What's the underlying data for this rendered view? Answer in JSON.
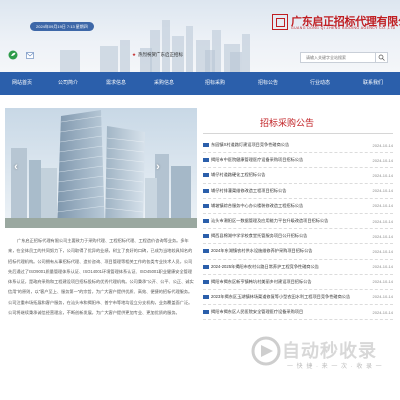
{
  "header": {
    "date_text": "2024年09月19日 7:13 星期四",
    "welcome_text": "热烈祝贺广东启正招标",
    "logo_title": "广东启正招标代理有限公司",
    "logo_subtitle": "GUANG DONG QI ZHENG BIDDING AGENCY CO.,LTD",
    "search_placeholder": "请输入关键字全站搜索"
  },
  "nav": {
    "items": [
      {
        "label": "网站首页"
      },
      {
        "label": "公司简介"
      },
      {
        "label": "需求信息"
      },
      {
        "label": "采购信息"
      },
      {
        "label": "招标采购"
      },
      {
        "label": "招标公告"
      },
      {
        "label": "行业动态"
      },
      {
        "label": "联系我们"
      }
    ]
  },
  "hero": {
    "prev_label": "‹",
    "next_label": "›"
  },
  "intro": {
    "text": "广东启正招标代理有限公司主要致力于采购代理、工程招标代理、工程造价咨询等业务。多年来，在全体员工的共同努力下，公司取得了优异的业绩，树立了良好的口碑，已成为当地较具知名的招标代理机构。公司拥有从事招标代理、造价咨询、项目管理等相关工作的各类专业技术人员，公司先后通过了ISO9001质量管理体系认证、ISO14001环境管理体系认证、ISO45001职业健康安全管理体系认证，是政府采购和工程建设项目招标投标的优秀代理机构。公司秉承“公开、公平、公正、诚实信用”的原则，以“客户至上、服务第一”的宗旨，为广大客户提供优质、高效、便捷的招标代理服务。公司注重市场拓展和客户服务，在汕头市和揭阳市、普宁市等地均设立分支机构，业务覆盖面广泛。公司将继续秉承诚信经营理念，不断创新发展，为广大客户提供更加专业、更加优质的服务。"
  },
  "announcements": {
    "title": "招标采购公告",
    "items": [
      {
        "title": "东园镇X村道路灯建设项目竞争性磋商公告",
        "date": "2024-10-14"
      },
      {
        "title": "揭阳市中医院健康管理医疗设备采购项目招标公告",
        "date": "2024-10-14"
      },
      {
        "title": "埔仔村道路硬化工程招标公告",
        "date": "2024-10-14"
      },
      {
        "title": "埔仔村排灌渠维修改造工程项目招标公告",
        "date": "2024-10-14"
      },
      {
        "title": "埔坡镇综合服务中心办公楼装修改造工程招标公告",
        "date": "2024-10-14"
      },
      {
        "title": "汕头市潮阳区一数据管理及应用能力平台升级改造项目招标公告",
        "date": "2024-10-14"
      },
      {
        "title": "揭西县棉湖中学学校食堂托管服务项目公开招标公告",
        "date": "2024-10-14"
      },
      {
        "title": "2024年东湖镇农村供水设施维修养护采购项目招标公告",
        "date": "2024-10-14"
      },
      {
        "title": "2024-2025年揭阳市农村公路日常养护工程竞争性磋商公告",
        "date": "2024-10-14"
      },
      {
        "title": "揭阳市揭东区新亨镇韩坑村美丽乡村建设项目招标公告",
        "date": "2024-10-14"
      },
      {
        "title": "2023年揭东区玉湖镇林场渠道修复等小型农田水利工程项目竞争性磋商公告",
        "date": "2024-10-14"
      },
      {
        "title": "揭阳市揭东区人民医院安全管理医疗设备采购项目",
        "date": "2024-10-14"
      }
    ]
  },
  "watermark": {
    "main": "自动秒收录",
    "sub": "一 快  捷 · 来  一 次 · 收 录 一"
  },
  "colors": {
    "brand_red": "#c01e22",
    "nav_blue": "#2b5fab"
  }
}
